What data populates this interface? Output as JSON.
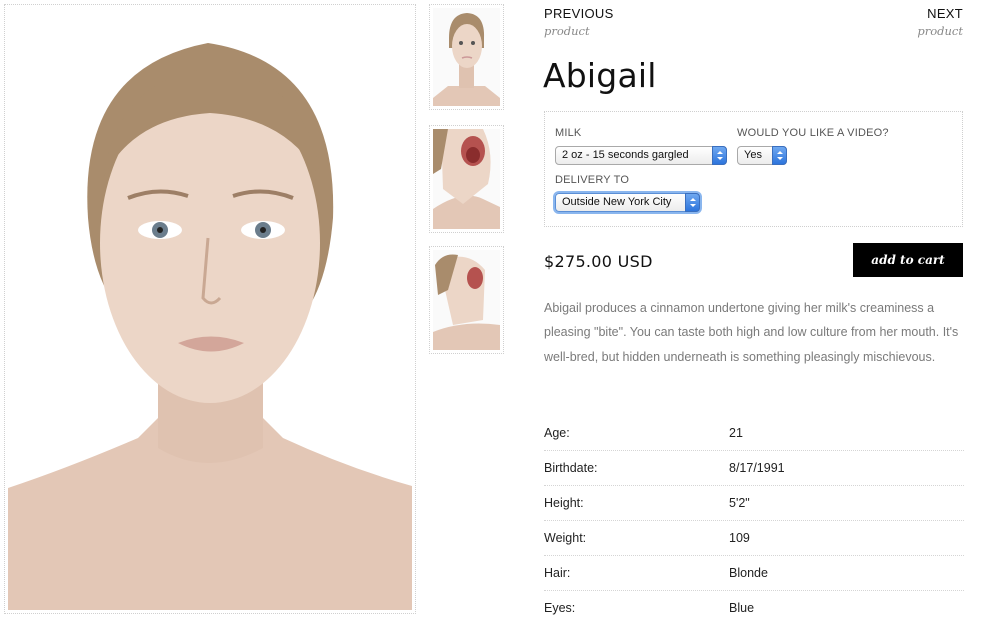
{
  "gallery": {
    "main_image": "portrait-front",
    "thumbnails": [
      "portrait-front",
      "mouth-open-side",
      "head-tilted-back"
    ]
  },
  "nav": {
    "previous_label": "PREVIOUS",
    "previous_sub": "product",
    "next_label": "NEXT",
    "next_sub": "product"
  },
  "product": {
    "title": "Abigail",
    "price": "$275.00 USD",
    "add_to_cart": "add to cart",
    "description": "Abigail produces a cinnamon undertone giving her milk's creaminess a pleasing \"bite\".  You can taste both high and low culture from her mouth. It's well-bred, but hidden underneath is something pleasingly mischievous."
  },
  "options": {
    "milk_label": "MILK",
    "milk_value": "2 oz - 15 seconds gargled",
    "video_label": "WOULD YOU LIKE A VIDEO?",
    "video_value": "Yes",
    "delivery_label": "DELIVERY TO",
    "delivery_value": "Outside New York City"
  },
  "specs": [
    {
      "key": "Age:",
      "value": "21"
    },
    {
      "key": "Birthdate:",
      "value": "8/17/1991"
    },
    {
      "key": "Height:",
      "value": "5'2\""
    },
    {
      "key": "Weight:",
      "value": "109"
    },
    {
      "key": "Hair:",
      "value": "Blonde"
    },
    {
      "key": "Eyes:",
      "value": "Blue"
    }
  ],
  "colors": {
    "button_bg": "#000000",
    "select_accent": "#2d74dc",
    "description_text": "#7a7a7a",
    "skin": "#e6cdbd",
    "hair": "#a98c6c"
  }
}
